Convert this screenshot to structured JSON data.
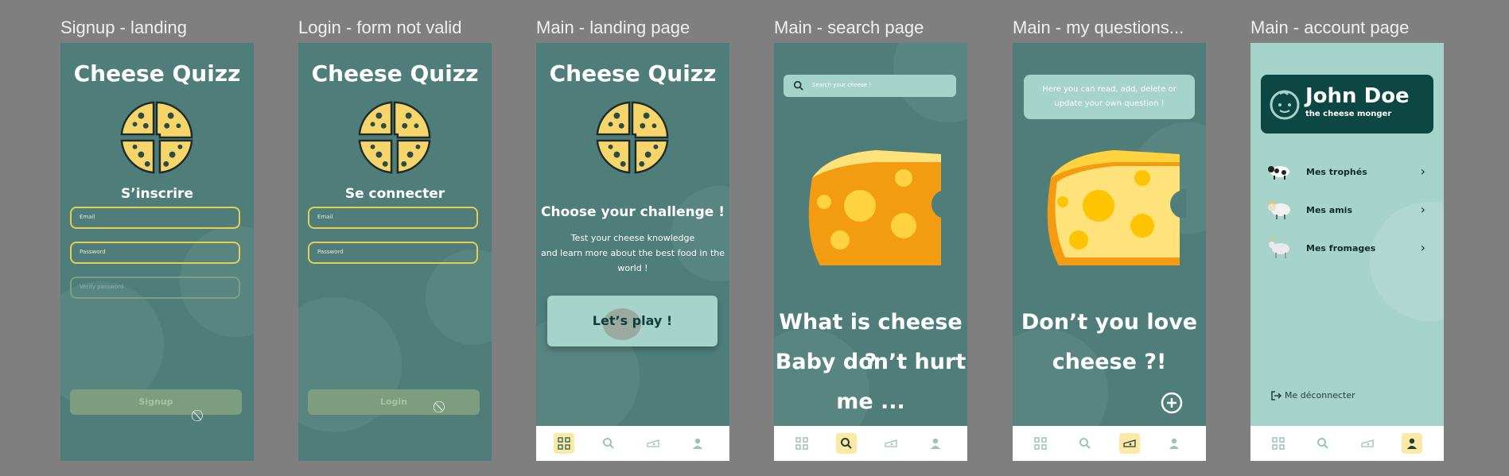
{
  "frames": {
    "signup": {
      "title": "Signup - landing",
      "app_title": "Cheese Quizz",
      "heading": "S’inscrire",
      "email_placeholder": "Email",
      "password_placeholder": "Password",
      "verify_placeholder": "Verify password",
      "submit_label": "Signup"
    },
    "login": {
      "title": "Login - form not valid",
      "app_title": "Cheese Quizz",
      "heading": "Se connecter",
      "email_placeholder": "Email",
      "password_placeholder": "Password",
      "submit_label": "Login"
    },
    "landing": {
      "title": "Main - landing page",
      "app_title": "Cheese Quizz",
      "heading": "Choose your challenge !",
      "text_line1": "Test your cheese knowledge",
      "text_line2": "and learn more about the best food in the",
      "text_line3": "world !",
      "cta_label": "Let’s play !"
    },
    "search": {
      "title": "Main - search page",
      "search_placeholder": "Search your cheese !",
      "line1": "What is cheese ?",
      "line2": "Baby don’t hurt",
      "line3": "me ..."
    },
    "questions": {
      "title": "Main - my questions...",
      "info_line1": "Here you can read, add, delete or",
      "info_line2": "update your own question !",
      "line1": "Don’t you love",
      "line2": "cheese ?!"
    },
    "account": {
      "title": "Main - account page",
      "name": "John Doe",
      "subtitle": "the cheese monger",
      "menu": [
        {
          "label": "Mes trophés"
        },
        {
          "label": "Mes amis"
        },
        {
          "label": "Mes fromages"
        }
      ],
      "logout_label": "Me déconnecter"
    }
  },
  "colors": {
    "screen_bg": "#4f7e7a",
    "light_bg": "#a6d3ca",
    "accent_yellow": "#e6cd55",
    "dark_green": "#0d4744",
    "nav_active": "#fde9a6"
  },
  "icons": [
    "grid-icon",
    "search-icon",
    "cheese-icon",
    "user-icon",
    "plus-circle-icon",
    "chevron-right-icon",
    "logout-icon",
    "baby-face-icon",
    "cow-icon",
    "sheep-icon",
    "goat-icon"
  ]
}
